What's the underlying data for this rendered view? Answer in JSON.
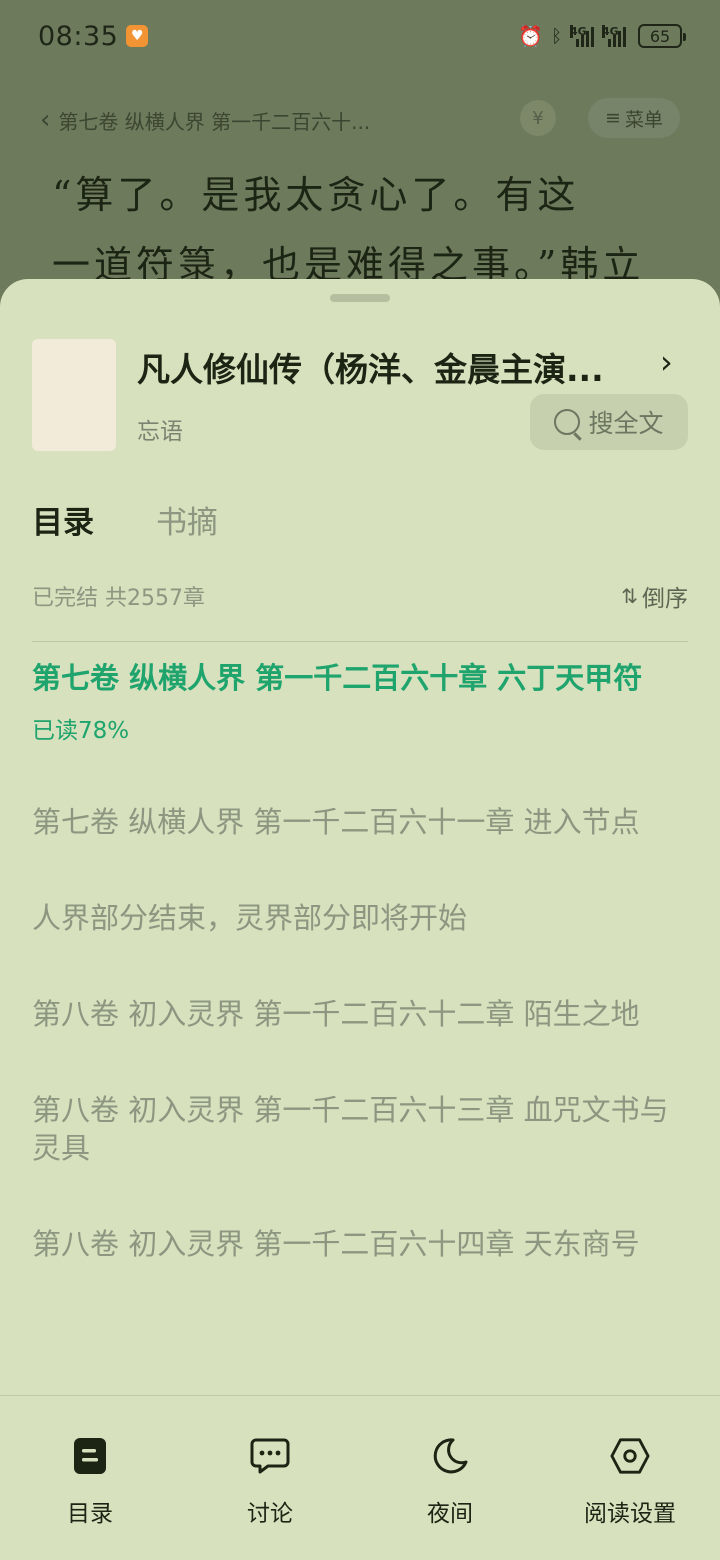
{
  "status_bar": {
    "time": "08:35",
    "battery": "65",
    "network_1": "4G",
    "network_2": "4G"
  },
  "reader": {
    "chapter_title": "第七卷 纵横人界 第一千二百六十...",
    "menu_label": "菜单",
    "text_line_1": "“算了。是我太贪心了。有这",
    "text_line_2": "一道符箓，也是难得之事。”韩立"
  },
  "book": {
    "title": "凡人修仙传（杨洋、金晨主演...",
    "author": "忘语",
    "search_label": "搜全文"
  },
  "tabs": [
    {
      "label": "目录",
      "active": true
    },
    {
      "label": "书摘",
      "active": false
    }
  ],
  "toc": {
    "status": "已完结 共2557章",
    "sort_label": "倒序",
    "current_chapter": "第七卷 纵横人界 第一千二百六十章 六丁天甲符",
    "current_progress": "已读78%",
    "chapters": [
      "第七卷 纵横人界  第一千二百六十一章 进入节点",
      "人界部分结束，灵界部分即将开始",
      "第八卷 初入灵界 第一千二百六十二章 陌生之地",
      "第八卷 初入灵界 第一千二百六十三章 血咒文书与灵具",
      "第八卷 初入灵界 第一千二百六十四章 天东商号"
    ]
  },
  "toolbar": {
    "toc_label": "目录",
    "discuss_label": "讨论",
    "night_label": "夜间",
    "settings_label": "阅读设置"
  },
  "colors": {
    "sheet_bg": "#d7e1be",
    "accent_green": "#1ea46c",
    "muted_text": "#8c9680"
  }
}
